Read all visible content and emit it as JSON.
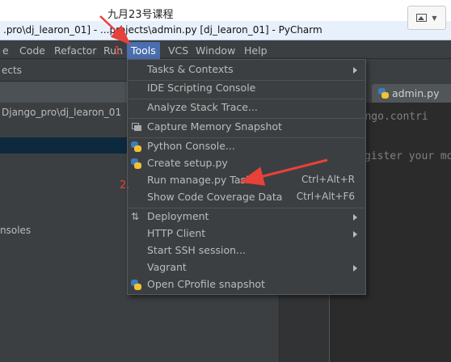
{
  "course_title": "九月23号课程",
  "window_title": ".pro\\dj_learon_01] - ...projects\\admin.py [dj_learon_01] - PyCharm",
  "menubar": [
    {
      "label": "e"
    },
    {
      "label": "Code"
    },
    {
      "label": "Refactor"
    },
    {
      "label": "Run"
    },
    {
      "label": "Tools"
    },
    {
      "label": "VCS"
    },
    {
      "label": "Window"
    },
    {
      "label": "Help"
    }
  ],
  "project_panel": {
    "header": "ects",
    "path": "Django_pro\\dj_learon_01",
    "consoles": "nsoles"
  },
  "editor": {
    "tab_label": "admin.py",
    "code_line_1": "django.contri",
    "code_line_2": "gister your mo"
  },
  "tools_menu": {
    "items": [
      {
        "label": "Tasks & Contexts",
        "shortcut": ""
      },
      {
        "label": "IDE Scripting Console",
        "shortcut": ""
      },
      {
        "label": "Analyze Stack Trace...",
        "shortcut": ""
      },
      {
        "label": "Capture Memory Snapshot",
        "shortcut": ""
      },
      {
        "label": "Python Console...",
        "shortcut": ""
      },
      {
        "label": "Create setup.py",
        "shortcut": ""
      },
      {
        "label": "Run manage.py Task...",
        "shortcut": "Ctrl+Alt+R"
      },
      {
        "label": "Show Code Coverage Data",
        "shortcut": "Ctrl+Alt+F6"
      },
      {
        "label": "Deployment",
        "shortcut": ""
      },
      {
        "label": "HTTP Client",
        "shortcut": ""
      },
      {
        "label": "Start SSH session...",
        "shortcut": ""
      },
      {
        "label": "Vagrant",
        "shortcut": ""
      },
      {
        "label": "Open CProfile snapshot",
        "shortcut": ""
      }
    ]
  },
  "annotations": {
    "step1": "1.",
    "step2": "2."
  },
  "colors": {
    "annotation": "#e8413a",
    "menu_active": "#4b6eaf",
    "panel_bg": "#3c3f41"
  }
}
